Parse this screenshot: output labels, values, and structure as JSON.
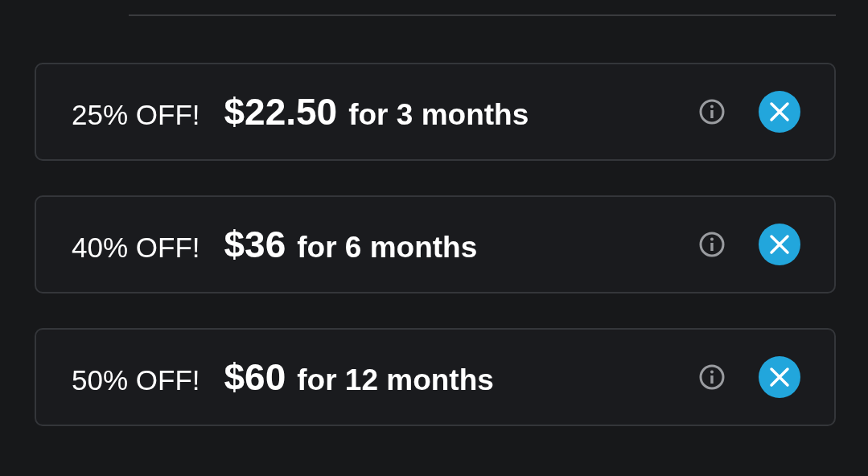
{
  "bundles": [
    {
      "discount": "25% OFF!",
      "price": "$22.50",
      "duration": "for 3 months"
    },
    {
      "discount": "40% OFF!",
      "price": "$36",
      "duration": "for 6 months"
    },
    {
      "discount": "50% OFF!",
      "price": "$60",
      "duration": "for 12 months"
    }
  ]
}
